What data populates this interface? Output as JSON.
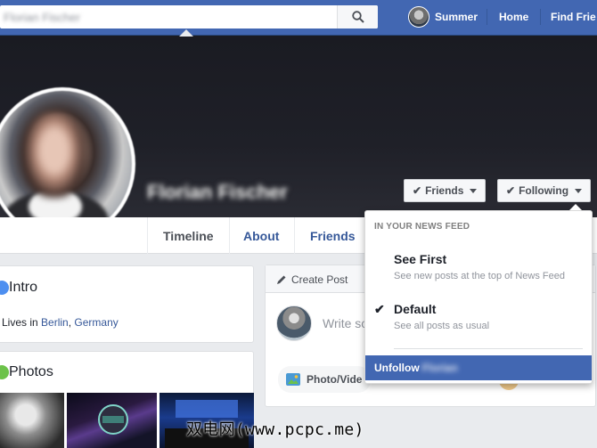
{
  "topbar": {
    "search_value": "Florian Fischer",
    "user_name": "Summer",
    "links": [
      "Home",
      "Find Frie"
    ]
  },
  "profile": {
    "name": "Florian Fischer",
    "friends_button": "Friends",
    "following_button": "Following"
  },
  "tabs": [
    "Timeline",
    "About",
    "Friends"
  ],
  "intro": {
    "title": "Intro",
    "lives_prefix": "Lives in ",
    "city": "Berlin",
    "separator": ", ",
    "country": "Germany"
  },
  "photos": {
    "title": "Photos"
  },
  "create_post": {
    "title": "Create Post",
    "placeholder": "Write so",
    "photo_video_label": "Photo/Vide"
  },
  "following_menu": {
    "header": "IN YOUR NEWS FEED",
    "options": [
      {
        "title": "See First",
        "subtitle": "See new posts at the top of News Feed",
        "checked": false
      },
      {
        "title": "Default",
        "subtitle": "See all posts as usual",
        "checked": true
      }
    ],
    "unfollow_label": "Unfollow",
    "unfollow_name": "Florian"
  },
  "watermark": "双电网(www.pcpc.me)",
  "colors": {
    "brand_blue": "#4267b2",
    "link_blue": "#365899",
    "page_bg": "#e9ebee",
    "cover_bg": "#1f2028"
  }
}
